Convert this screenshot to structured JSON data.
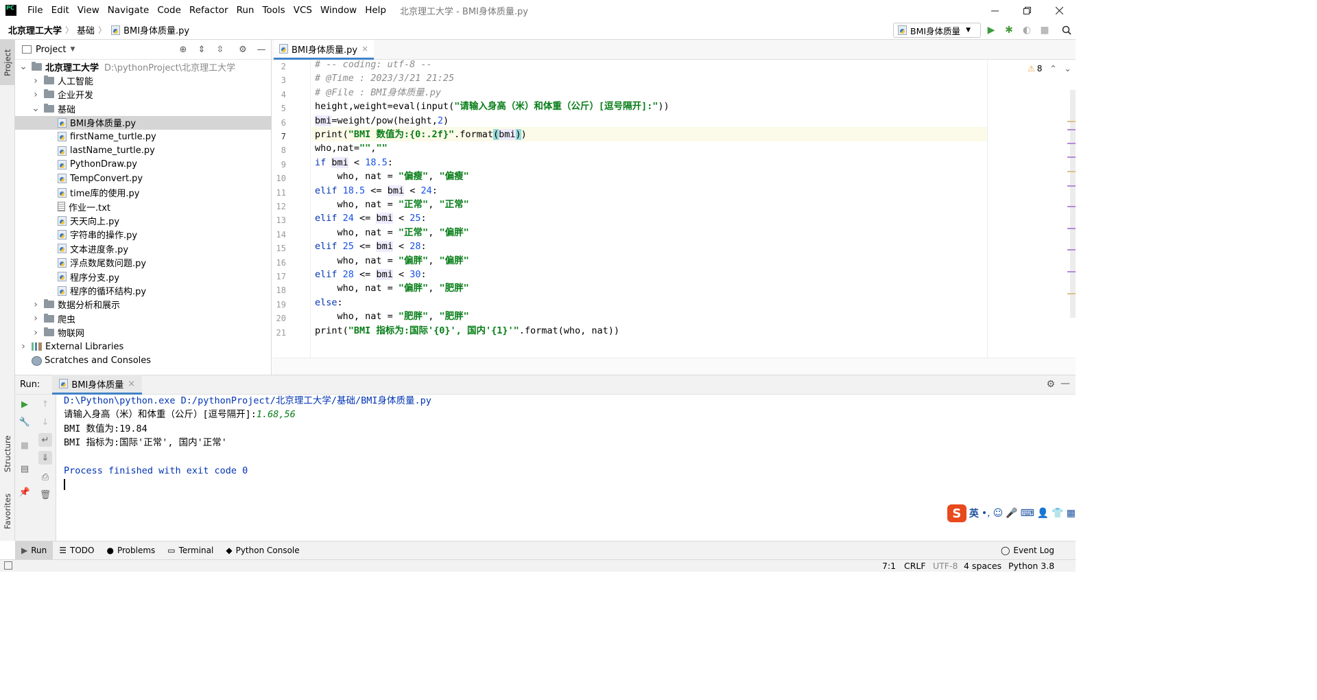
{
  "window": {
    "title": "北京理工大学 - BMI身体质量.py",
    "menu": [
      "File",
      "Edit",
      "View",
      "Navigate",
      "Code",
      "Refactor",
      "Run",
      "Tools",
      "VCS",
      "Window",
      "Help"
    ]
  },
  "breadcrumb": [
    "北京理工大学",
    "基础",
    "BMI身体质量.py"
  ],
  "run_config": "BMI身体质量",
  "left_strip": {
    "project": "Project",
    "structure": "Structure",
    "favorites": "Favorites"
  },
  "project": {
    "header": "Project",
    "root_name": "北京理工大学",
    "root_path": "D:\\pythonProject\\北京理工大学",
    "folders_top": [
      "人工智能",
      "企业开发"
    ],
    "open_folder": "基础",
    "files": [
      {
        "name": "BMI身体质量.py",
        "type": "py",
        "selected": true
      },
      {
        "name": "firstName_turtle.py",
        "type": "py"
      },
      {
        "name": "lastName_turtle.py",
        "type": "py"
      },
      {
        "name": "PythonDraw.py",
        "type": "py"
      },
      {
        "name": "TempConvert.py",
        "type": "py"
      },
      {
        "name": "time库的使用.py",
        "type": "py"
      },
      {
        "name": "作业一.txt",
        "type": "txt"
      },
      {
        "name": "天天向上.py",
        "type": "py"
      },
      {
        "name": "字符串的操作.py",
        "type": "py"
      },
      {
        "name": "文本进度条.py",
        "type": "py"
      },
      {
        "name": "浮点数尾数问题.py",
        "type": "py"
      },
      {
        "name": "程序分支.py",
        "type": "py"
      },
      {
        "name": "程序的循环结构.py",
        "type": "py"
      }
    ],
    "folders_bottom": [
      "数据分析和展示",
      "爬虫",
      "物联网"
    ],
    "external": "External Libraries",
    "scratches": "Scratches and Consoles"
  },
  "editor": {
    "tab": "BMI身体质量.py",
    "warnings": "8",
    "current_line": 7,
    "line_numbers": [
      "2",
      "3",
      "4",
      "5",
      "6",
      "7",
      "8",
      "9",
      "10",
      "11",
      "12",
      "13",
      "14",
      "15",
      "16",
      "17",
      "18",
      "19",
      "20",
      "21"
    ]
  },
  "run": {
    "label": "Run:",
    "tab": "BMI身体质量",
    "output": [
      {
        "text": "D:\\Python\\python.exe D:/pythonProject/北京理工大学/基础/BMI身体质量.py",
        "style": "blue"
      },
      {
        "text": "请输入身高（米）和体重（公斤）[逗号隔开]:",
        "style": "plain",
        "input": "1.68,56"
      },
      {
        "text": "BMI 数值为:19.84",
        "style": "plain"
      },
      {
        "text": "BMI 指标为:国际'正常', 国内'正常'",
        "style": "plain"
      },
      {
        "text": "",
        "style": "plain"
      },
      {
        "text": "Process finished with exit code 0",
        "style": "blue"
      }
    ]
  },
  "ime": {
    "lang": "英",
    "punct": "•,"
  },
  "bottom_tabs": [
    "Run",
    "TODO",
    "Problems",
    "Terminal",
    "Python Console"
  ],
  "event_log": "Event Log",
  "status": {
    "position": "7:1",
    "line_sep": "CRLF",
    "encoding": "UTF-8",
    "indent": "4 spaces",
    "interpreter": "Python 3.8"
  }
}
